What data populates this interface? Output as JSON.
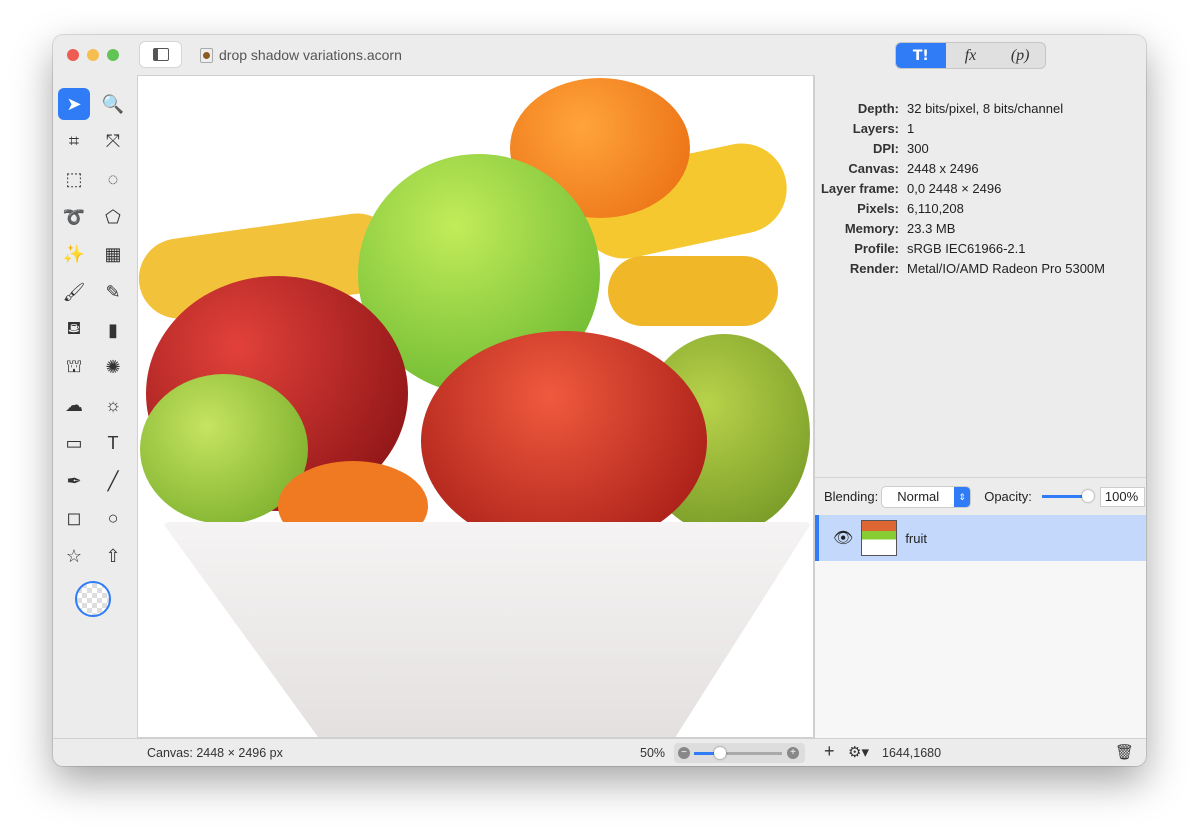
{
  "window": {
    "title": "drop shadow variations.acorn",
    "colors": {
      "close": "#ee5c54",
      "minimize": "#f6be4f",
      "zoom": "#61c454",
      "accent": "#2f7cf6"
    }
  },
  "inspector_tabs": [
    {
      "icon": "tools-icon",
      "label": "",
      "selected": true
    },
    {
      "icon": "fx-icon",
      "label": "fx"
    },
    {
      "icon": "properties-icon",
      "label": "(p)"
    }
  ],
  "tools": [
    "select-arrow",
    "zoom",
    "crop",
    "transform",
    "rect-select",
    "ellipse-select",
    "lasso",
    "polygon-lasso",
    "magic-wand",
    "color-select",
    "brush",
    "pencil",
    "paint-bucket",
    "eraser",
    "clone-stamp",
    "smudge",
    "cloud-burn",
    "sun-dodge",
    "gradient",
    "text",
    "bezier-pen",
    "line",
    "rectangle",
    "circle",
    "star",
    "arrow"
  ],
  "info": [
    {
      "k": "Depth:",
      "v": "32 bits/pixel, 8 bits/channel"
    },
    {
      "k": "Layers:",
      "v": "1"
    },
    {
      "k": "DPI:",
      "v": "300"
    },
    {
      "k": "Canvas:",
      "v": "2448 x 2496"
    },
    {
      "k": "Layer frame:",
      "v": "0,0 2448 × 2496"
    },
    {
      "k": "Pixels:",
      "v": "6,110,208"
    },
    {
      "k": "Memory:",
      "v": "23.3 MB"
    },
    {
      "k": "Profile:",
      "v": "sRGB IEC61966-2.1"
    },
    {
      "k": "Render:",
      "v": "Metal/IO/AMD Radeon Pro 5300M"
    }
  ],
  "blending": {
    "label": "Blending:",
    "value": "Normal",
    "opacity_label": "Opacity:",
    "opacity": "100%"
  },
  "layers": [
    {
      "name": "fruit",
      "visible": true,
      "selected": true
    }
  ],
  "status": {
    "canvas": "Canvas: 2448 × 2496 px",
    "zoom": "50%",
    "coords": "1644,1680"
  }
}
